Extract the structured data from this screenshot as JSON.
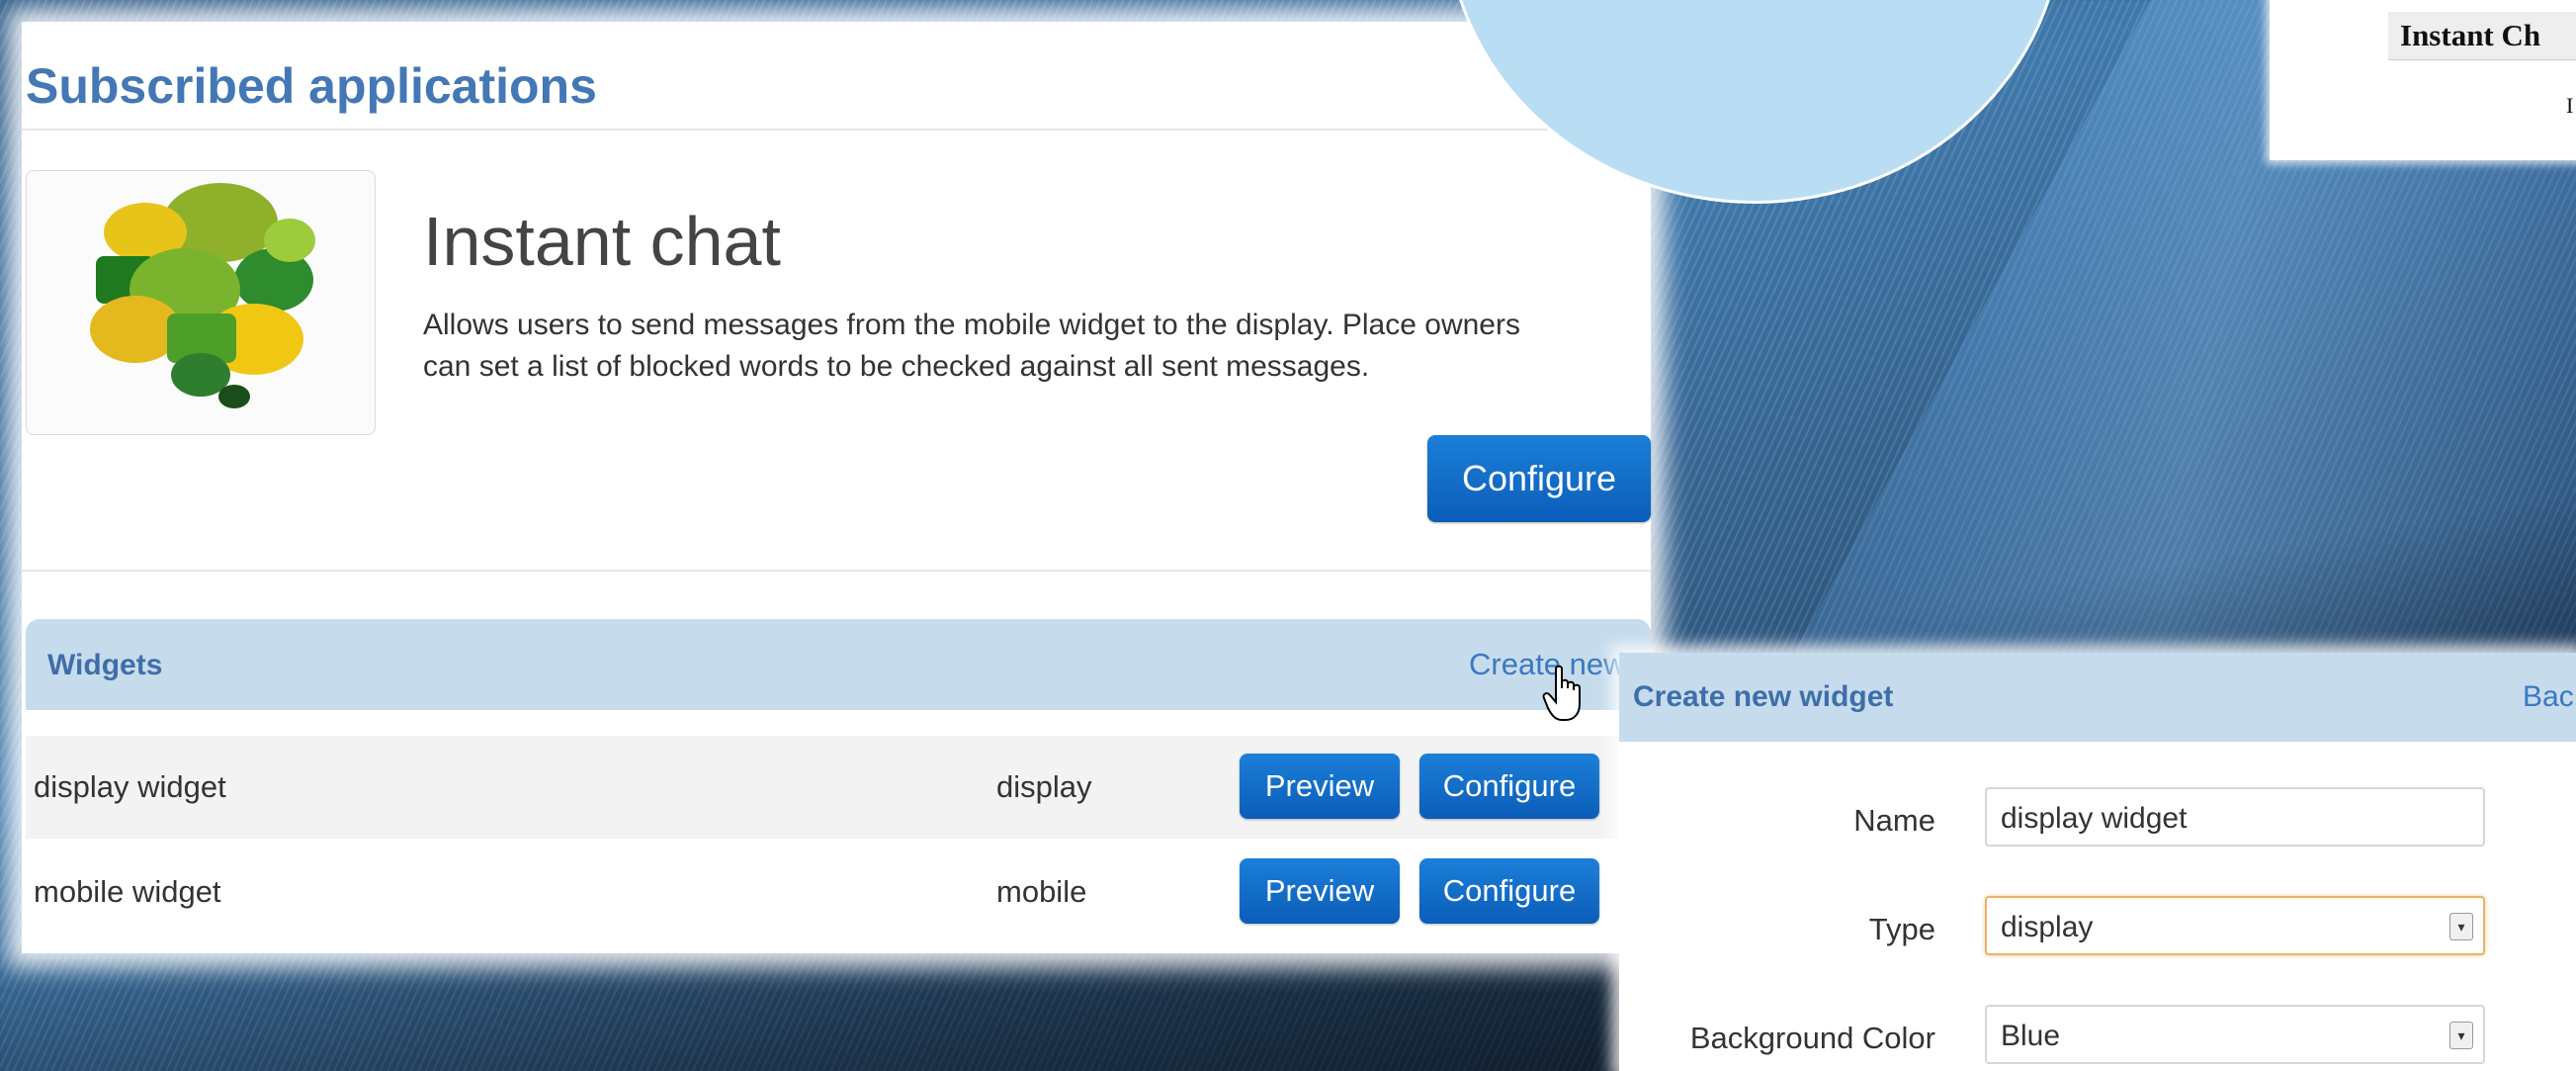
{
  "main": {
    "title": "Subscribed applications",
    "app": {
      "name": "Instant chat",
      "description": "Allows users to send messages from the mobile widget to the display. Place owners can set a list of blocked words to be checked against all sent messages.",
      "configure_label": "Configure",
      "logo_icon": "speech-bubbles-icon"
    },
    "widgets": {
      "title": "Widgets",
      "create_new_label": "Create new",
      "rows": [
        {
          "name": "display widget",
          "type": "display",
          "preview_label": "Preview",
          "configure_label": "Configure"
        },
        {
          "name": "mobile widget",
          "type": "mobile",
          "preview_label": "Preview",
          "configure_label": "Configure"
        }
      ]
    }
  },
  "snippet": {
    "title": "Instant Ch",
    "text": "I"
  },
  "create_widget": {
    "title": "Create new widget",
    "back_label": "Bac",
    "fields": {
      "name": {
        "label": "Name",
        "value": "display widget"
      },
      "type": {
        "label": "Type",
        "value": "display"
      },
      "background_color": {
        "label": "Background Color",
        "value": "Blue"
      }
    }
  },
  "colors": {
    "heading_blue": "#4477b5",
    "header_bar": "#c6dcec",
    "button_blue": "#0b5db8",
    "focus_orange": "#e8b46a"
  }
}
